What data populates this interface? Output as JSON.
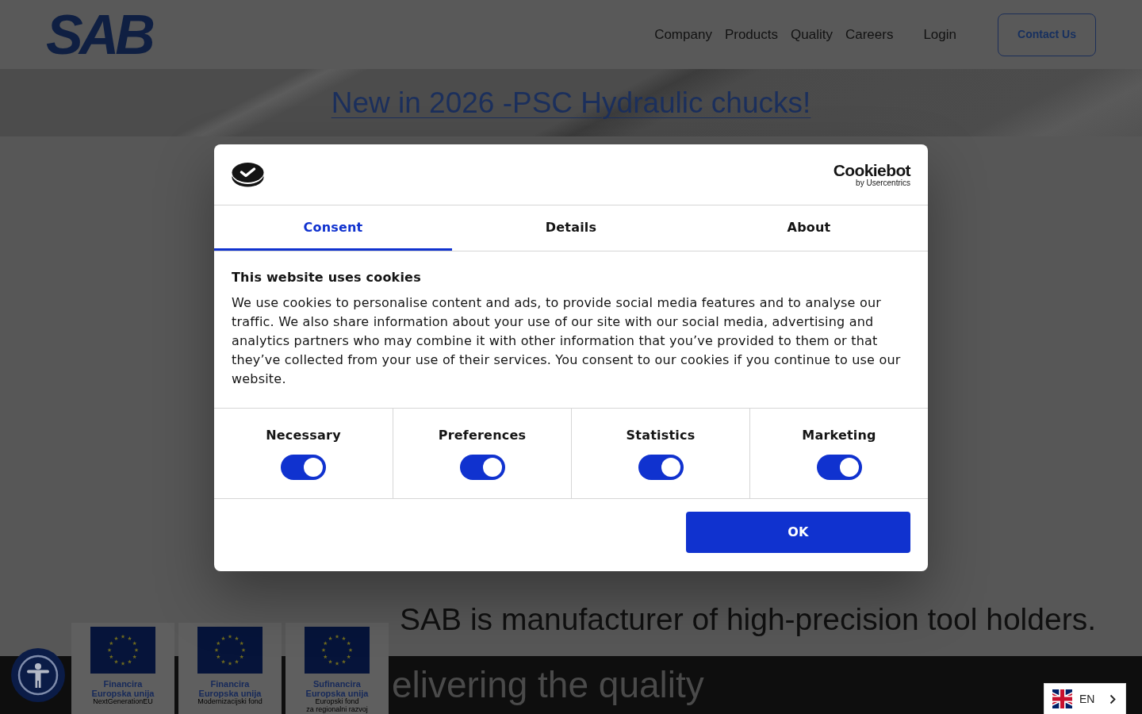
{
  "header": {
    "logo": "SAB",
    "nav": [
      "Company",
      "Products",
      "Quality",
      "Careers"
    ],
    "login": "Login",
    "contact_button": "Contact Us"
  },
  "banner": {
    "title": "New in 2026 -PSC Hydraulic chucks!"
  },
  "cookie_dialog": {
    "brand": {
      "name": "Cookiebot",
      "tagline": "by Usercentrics"
    },
    "tabs": [
      {
        "label": "Consent",
        "selected": true
      },
      {
        "label": "Details",
        "selected": false
      },
      {
        "label": "About",
        "selected": false
      }
    ],
    "heading": "This website uses cookies",
    "body": "We use cookies to personalise content and ads, to provide social media features and to analyse our traffic. We also share information about your use of our site with our social media, advertising and analytics partners who may combine it with other information that you’ve provided to them or that they’ve collected from your use of their services. You consent to our cookies if you continue to use our website.",
    "categories": [
      {
        "label": "Necessary",
        "checked": true
      },
      {
        "label": "Preferences",
        "checked": true
      },
      {
        "label": "Statistics",
        "checked": true
      },
      {
        "label": "Marketing",
        "checked": true
      }
    ],
    "ok_button": "OK"
  },
  "intro": {
    "headline": "SAB is manufacturer of high-precision tool holders.",
    "subheadline": "elivering the quality"
  },
  "funding_logos": [
    {
      "title_lines": [
        "Financira",
        "Europska unija"
      ],
      "fund_lines": [
        "NextGenerationEU"
      ]
    },
    {
      "title_lines": [
        "Financira",
        "Europska unija"
      ],
      "fund_lines": [
        "Modernizacijski fond"
      ]
    },
    {
      "title_lines": [
        "Sufinancira",
        "Europska unija"
      ],
      "fund_lines": [
        "Europski fond",
        "za regionalni razvoj"
      ]
    }
  ],
  "language_selector": {
    "code": "EN"
  }
}
